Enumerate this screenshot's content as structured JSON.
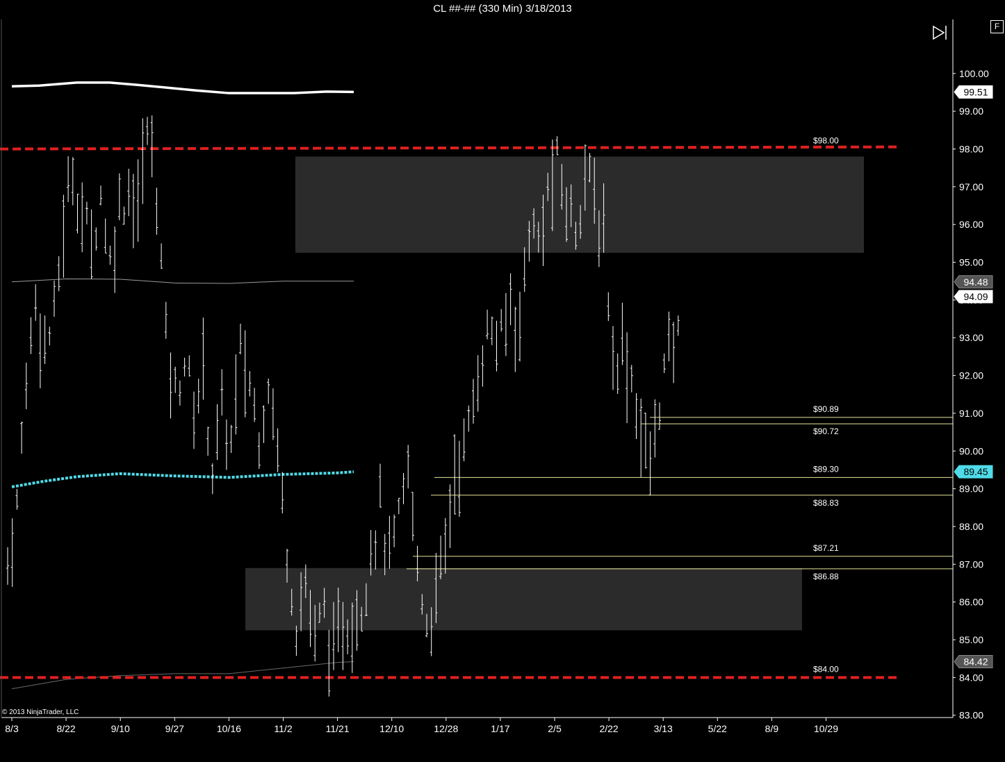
{
  "window": {
    "title": "CL ##-## (330 Min)  3/18/2013",
    "corner_button": "F",
    "copyright": "© 2013 NinjaTrader, LLC"
  },
  "colors": {
    "background": "#000000",
    "bars": "#ffffff",
    "support_resistance": "#e02020",
    "ma_fast": "#4fdbe8",
    "level_lines": "#e6e69a",
    "zone": "#2b2b2b"
  },
  "chart_data": {
    "type": "ohlc",
    "instrument": "CL ##-##",
    "interval": "330 Min",
    "date": "3/18/2013",
    "ylim": [
      83.0,
      100.6
    ],
    "y_ticks": [
      83.0,
      84.0,
      85.0,
      86.0,
      87.0,
      88.0,
      89.0,
      90.0,
      91.0,
      92.0,
      93.0,
      94.0,
      95.0,
      96.0,
      97.0,
      98.0,
      99.0,
      100.0
    ],
    "x_ticks": [
      "8/3",
      "8/22",
      "9/10",
      "9/27",
      "10/16",
      "11/2",
      "11/21",
      "12/10",
      "12/28",
      "1/17",
      "2/5",
      "2/22",
      "3/13",
      "5/22",
      "8/9",
      "10/29"
    ],
    "price_path": [
      [
        0,
        87.0
      ],
      [
        2,
        88.5
      ],
      [
        4,
        92.0
      ],
      [
        6,
        94.0
      ],
      [
        8,
        92.8
      ],
      [
        10,
        93.5
      ],
      [
        12,
        96.0
      ],
      [
        14,
        97.5
      ],
      [
        16,
        96.2
      ],
      [
        18,
        95.5
      ],
      [
        20,
        96.8
      ],
      [
        22,
        95.0
      ],
      [
        24,
        96.5
      ],
      [
        26,
        97.0
      ],
      [
        28,
        96.5
      ],
      [
        30,
        98.5
      ],
      [
        32,
        97.0
      ],
      [
        34,
        93.0
      ],
      [
        36,
        91.5
      ],
      [
        38,
        92.5
      ],
      [
        40,
        91.0
      ],
      [
        42,
        92.2
      ],
      [
        44,
        89.5
      ],
      [
        46,
        91.0
      ],
      [
        48,
        90.2
      ],
      [
        50,
        92.5
      ],
      [
        52,
        91.8
      ],
      [
        54,
        90.5
      ],
      [
        56,
        92.0
      ],
      [
        58,
        90.0
      ],
      [
        60,
        87.5
      ],
      [
        62,
        85.5
      ],
      [
        64,
        86.5
      ],
      [
        66,
        85.0
      ],
      [
        68,
        85.8
      ],
      [
        70,
        84.3
      ],
      [
        72,
        85.5
      ],
      [
        74,
        85.5
      ],
      [
        76,
        86.0
      ],
      [
        78,
        87.5
      ],
      [
        80,
        88.5
      ],
      [
        82,
        87.0
      ],
      [
        84,
        88.0
      ],
      [
        86,
        89.5
      ],
      [
        88,
        87.0
      ],
      [
        90,
        85.5
      ],
      [
        92,
        86.0
      ],
      [
        94,
        87.5
      ],
      [
        96,
        89.5
      ],
      [
        98,
        90.0
      ],
      [
        100,
        91.2
      ],
      [
        102,
        92.8
      ],
      [
        104,
        93.2
      ],
      [
        106,
        92.8
      ],
      [
        108,
        94.0
      ],
      [
        110,
        93.3
      ],
      [
        112,
        96.0
      ],
      [
        114,
        95.5
      ],
      [
        116,
        96.8
      ],
      [
        118,
        97.5
      ],
      [
        120,
        96.5
      ],
      [
        122,
        96.0
      ],
      [
        124,
        97.5
      ],
      [
        126,
        96.5
      ],
      [
        128,
        95.8
      ],
      [
        130,
        92.5
      ],
      [
        132,
        92.8
      ],
      [
        134,
        92.0
      ],
      [
        136,
        90.5
      ],
      [
        138,
        89.5
      ],
      [
        140,
        91.5
      ],
      [
        142,
        92.5
      ],
      [
        144,
        93.0
      ]
    ],
    "moving_averages": [
      {
        "name": "slow",
        "color": "#ffffff",
        "value_label": "99.51",
        "points": [
          [
            8.0,
            99.66
          ],
          [
            8.5,
            99.68
          ],
          [
            9.2,
            99.76
          ],
          [
            9.8,
            99.76
          ],
          [
            10.3,
            99.7
          ],
          [
            10.9,
            99.62
          ],
          [
            11.4,
            99.55
          ],
          [
            12.0,
            99.48
          ],
          [
            12.6,
            99.48
          ],
          [
            13.2,
            99.48
          ],
          [
            13.8,
            99.52
          ],
          [
            14.3,
            99.51
          ]
        ]
      },
      {
        "name": "mid",
        "color": "#9a9a9a",
        "value_label": "94.48",
        "points": [
          [
            8.0,
            94.48
          ],
          [
            9.0,
            94.56
          ],
          [
            10.0,
            94.55
          ],
          [
            11.0,
            94.45
          ],
          [
            12.0,
            94.44
          ],
          [
            13.0,
            94.5
          ],
          [
            14.3,
            94.5
          ]
        ]
      },
      {
        "name": "fast",
        "color": "#4fdbe8",
        "value_label": "89.45",
        "points": [
          [
            8.0,
            89.05
          ],
          [
            8.6,
            89.2
          ],
          [
            9.2,
            89.32
          ],
          [
            10.0,
            89.4
          ],
          [
            11.0,
            89.34
          ],
          [
            12.0,
            89.3
          ],
          [
            13.0,
            89.38
          ],
          [
            14.0,
            89.42
          ],
          [
            14.3,
            89.45
          ]
        ]
      },
      {
        "name": "long",
        "color": "#6a6a6a",
        "value_label": "84.42",
        "points": [
          [
            8.0,
            83.7
          ],
          [
            9.0,
            83.95
          ],
          [
            10.0,
            84.05
          ],
          [
            11.0,
            84.1
          ],
          [
            12.0,
            84.1
          ],
          [
            13.0,
            84.25
          ],
          [
            14.0,
            84.4
          ],
          [
            14.3,
            84.42
          ]
        ]
      }
    ],
    "last_price_label": "94.09",
    "horizontal_levels": [
      {
        "label": "$98.00",
        "value": 98.0,
        "style": "dashed-red"
      },
      {
        "label": "$84.00",
        "value": 84.0,
        "style": "dashed-red"
      },
      {
        "label": "$90.89",
        "value": 90.89,
        "style": "thin"
      },
      {
        "label": "$90.72",
        "value": 90.72,
        "style": "thin"
      },
      {
        "label": "$89.30",
        "value": 89.3,
        "style": "thin"
      },
      {
        "label": "$88.83",
        "value": 88.83,
        "style": "thin"
      },
      {
        "label": "$87.21",
        "value": 87.21,
        "style": "thin"
      },
      {
        "label": "$86.88",
        "value": 86.88,
        "style": "thin"
      }
    ],
    "zones": [
      {
        "name": "upper-zone",
        "y_range": [
          95.25,
          97.8
        ]
      },
      {
        "name": "lower-zone",
        "y_range": [
          85.25,
          86.9
        ]
      }
    ],
    "grid": false
  }
}
